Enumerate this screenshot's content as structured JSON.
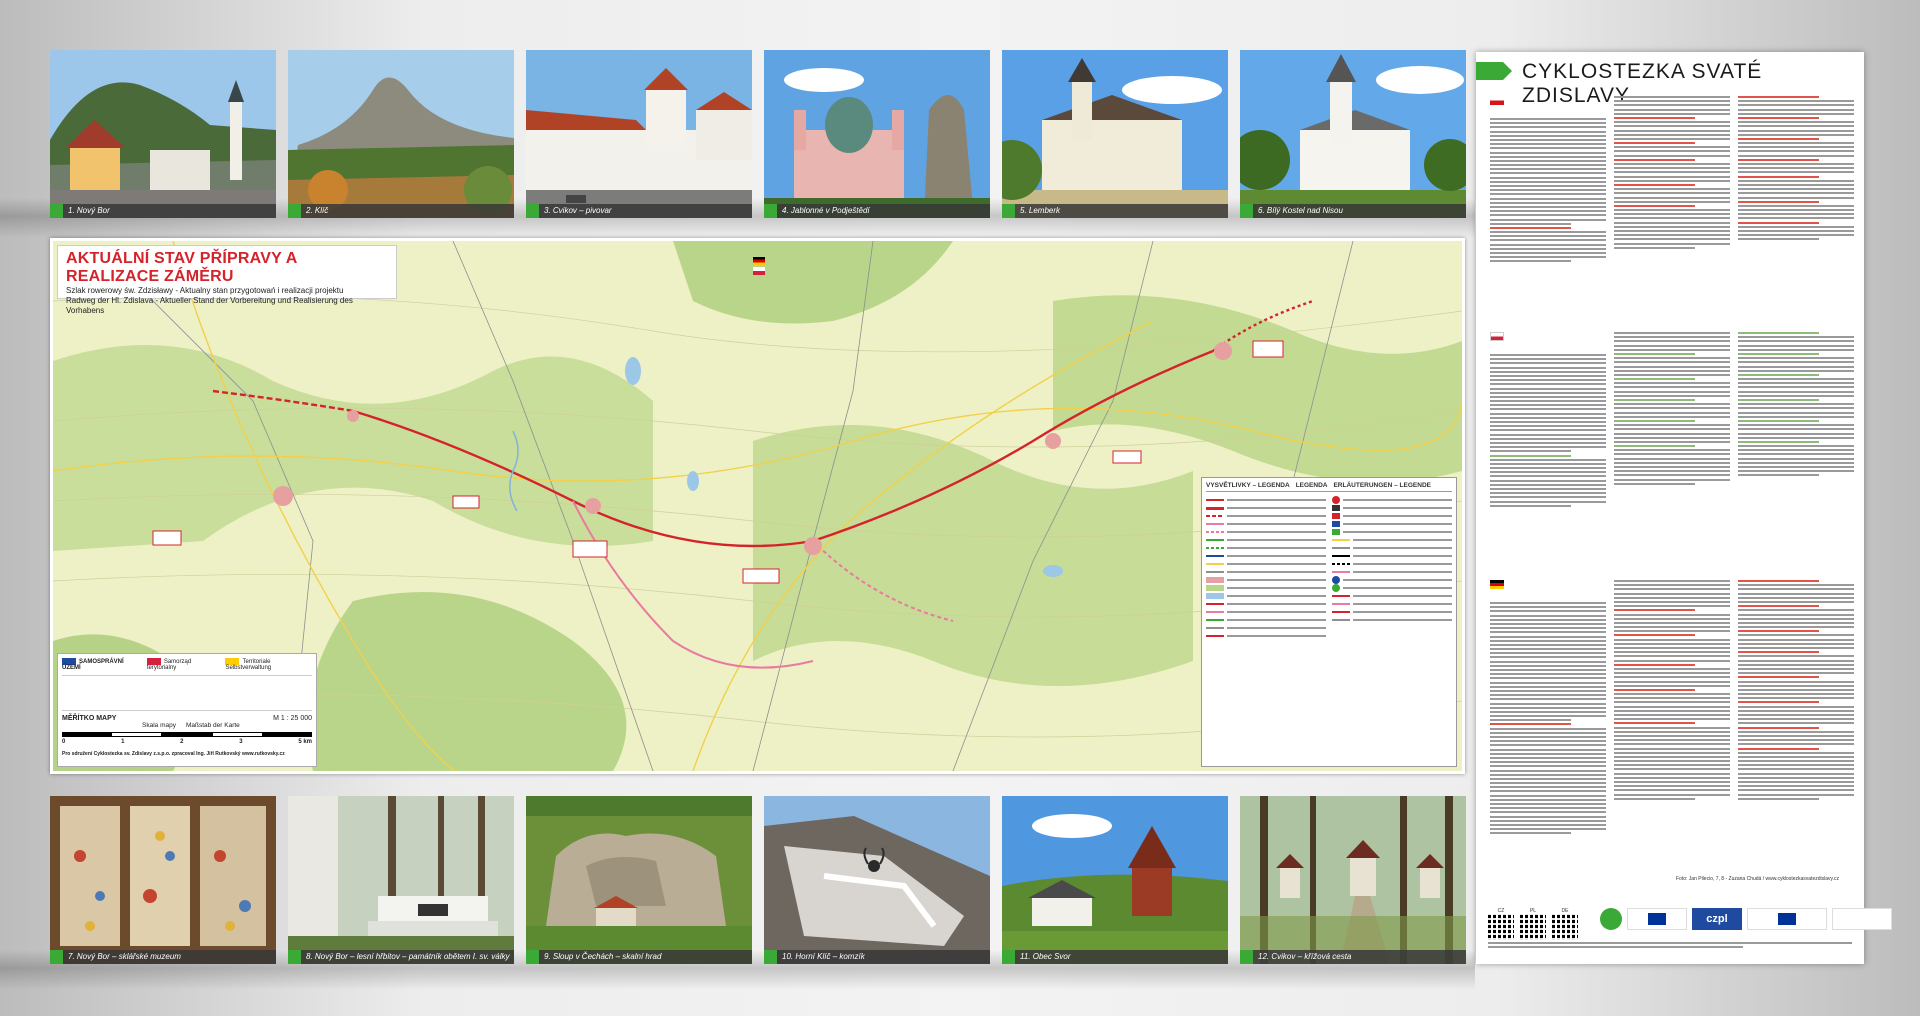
{
  "photos_top": [
    {
      "caption": "1. Nový Bor"
    },
    {
      "caption": "2. Klíč"
    },
    {
      "caption": "3. Cvikov – pivovar"
    },
    {
      "caption": "4. Jablonné v Podještědí"
    },
    {
      "caption": "5. Lemberk"
    },
    {
      "caption": "6. Bílý Kostel nad Nisou"
    }
  ],
  "photos_bottom": [
    {
      "caption": "7. Nový Bor – sklářské muzeum"
    },
    {
      "caption": "8. Nový Bor – lesní hřbitov – památník obětem I. sv. války"
    },
    {
      "caption": "9. Sloup v Čechách – skalní hrad"
    },
    {
      "caption": "10. Horní Klíč – komzík"
    },
    {
      "caption": "11. Obec Svor"
    },
    {
      "caption": "12. Cvikov – křížová cesta"
    }
  ],
  "map": {
    "title": "AKTUÁLNÍ STAV PŘÍPRAVY A REALIZACE ZÁMĚRU",
    "subtitle_pl": "Szlak rowerowy św. Zdzisławy - Aktualny stan przygotowań i realizacji projektu",
    "subtitle_de": "Radweg der Hl. Zdislava - Aktueller Stand der Vorbereitung und Realisierung des Vorhabens",
    "legend_small": {
      "samosprava": "SAMOSPRÁVNÍ ÚZEMÍ",
      "samorzad": "Samorząd terytorialny",
      "selbst": "Territoriale Selbstverwaltung",
      "scale_title": "MĚŘÍTKO MAPY",
      "scale_pl": "Skala mapy",
      "scale_de": "Maßstab der Karte",
      "scale_ratio": "M 1 : 25 000",
      "ticks": [
        "0",
        "1",
        "2",
        "3",
        "5 km"
      ],
      "publisher": "Pro sdružení Cyklostezka sv. Zdislavy z.s.p.o. zpracoval Ing. Jiří Rutkovský  www.rutkovsky.cz"
    },
    "legend_big": {
      "cz": "VYSVĚTLIVKY – LEGENDA",
      "pl": "LEGENDA",
      "de": "ERLÄUTERUNGEN – LEGENDE"
    },
    "colors": {
      "route_red": "#d4232b",
      "route_pink": "#e97aa0",
      "water": "#9cc7e6",
      "forest": "#b9d58a",
      "field": "#eef1c6"
    }
  },
  "right_panel": {
    "title": "CYKLOSTEZKA SVATÉ ZDISLAVY",
    "credit": "Foto: Jan Pilecio, 7, 8 - Zuzana Chudá  /  www.cyklostezkasvatezdislavy.cz",
    "qr_labels": [
      "CZ",
      "PL",
      "DE"
    ],
    "logo_text": "czpl"
  }
}
